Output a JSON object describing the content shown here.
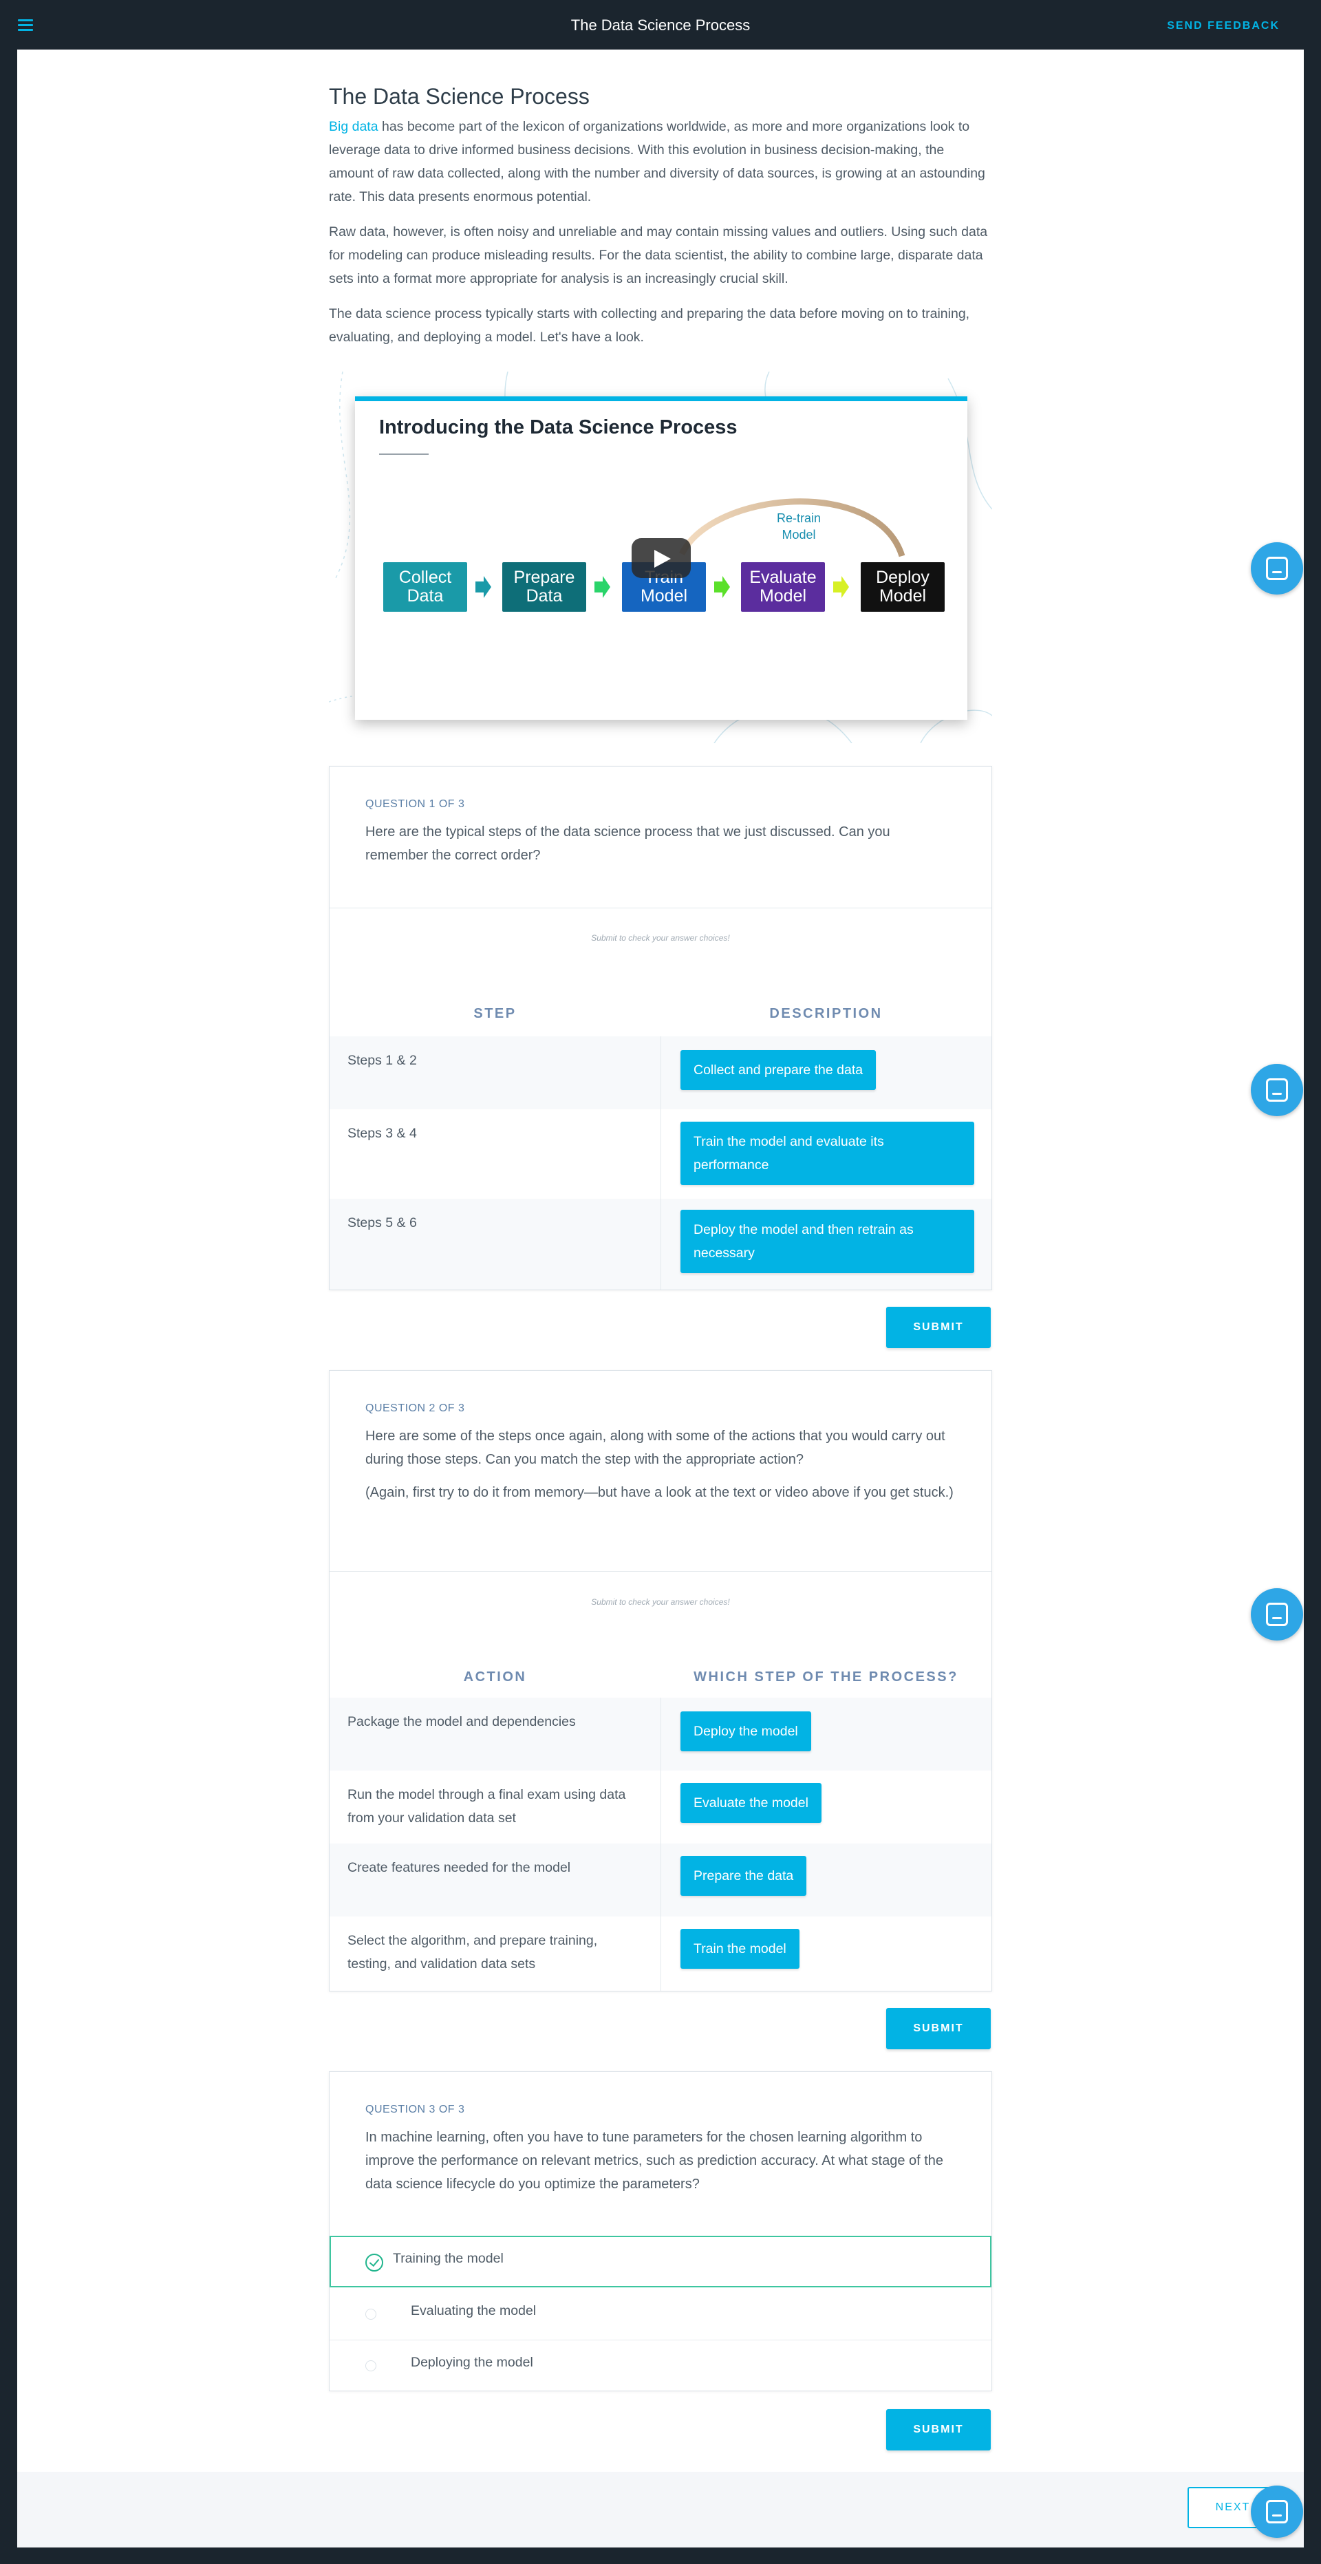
{
  "topbar": {
    "title": "The Data Science Process",
    "send_feedback": "SEND FEEDBACK"
  },
  "lesson": {
    "title": "The Data Science Process",
    "intro": {
      "link_text": "Big data",
      "p1_rest": " has become part of the lexicon of organizations worldwide, as more and more organizations look to leverage data to drive informed business decisions. With this evolution in business decision-making, the amount of raw data collected, along with the number and diversity of data sources, is growing at an astounding rate. This data presents enormous potential.",
      "p2": "Raw data, however, is often noisy and unreliable and may contain missing values and outliers. Using such data for modeling can produce misleading results. For the data scientist, the ability to combine large, disparate data sets into a format more appropriate for analysis is an increasingly crucial skill.",
      "p3": "The data science process typically starts with collecting and preparing the data before moving on to training, evaluating, and deploying a model. Let's have a look."
    }
  },
  "video": {
    "title": "Introducing the Data Science Process",
    "retrain_label": "Re-train Model",
    "steps": [
      {
        "label": "Collect Data",
        "color": "#1a9aa8"
      },
      {
        "label": "Prepare Data",
        "color": "#0e6e78"
      },
      {
        "label": "Train Model",
        "color": "#1565c0"
      },
      {
        "label": "Evaluate Model",
        "color": "#5b2d9e"
      },
      {
        "label": "Deploy Model",
        "color": "#111111"
      }
    ]
  },
  "q1": {
    "number": "QUESTION 1 OF 3",
    "text": "Here are the typical steps of the data science process that we just discussed. Can you remember the correct order?",
    "hint": "Submit to check your answer choices!",
    "col_left": "STEP",
    "col_right": "DESCRIPTION",
    "rows": [
      {
        "left": "Steps 1 & 2",
        "right": "Collect and prepare the data"
      },
      {
        "left": "Steps 3 & 4",
        "right": "Train the model and evaluate its performance"
      },
      {
        "left": "Steps 5 & 6",
        "right": "Deploy the model and then retrain as necessary"
      }
    ],
    "submit": "SUBMIT"
  },
  "q2": {
    "number": "QUESTION 2 OF 3",
    "text": "Here are some of the steps once again, along with some of the actions that you would carry out during those steps. Can you match the step with the appropriate action?",
    "text2": "(Again, first try to do it from memory—but have a look at the text or video above if you get stuck.)",
    "hint": "Submit to check your answer choices!",
    "col_left": "ACTION",
    "col_right": "WHICH STEP OF THE PROCESS?",
    "rows": [
      {
        "left": "Package the model and dependencies",
        "right": "Deploy the model"
      },
      {
        "left": "Run the model through a final exam using data from your validation data set",
        "right": "Evaluate the model"
      },
      {
        "left": "Create features needed for the model",
        "right": "Prepare the data"
      },
      {
        "left": "Select the algorithm, and prepare training, testing, and validation data sets",
        "right": "Train the model"
      }
    ],
    "submit": "SUBMIT"
  },
  "q3": {
    "number": "QUESTION 3 OF 3",
    "text": "In machine learning, often you have to tune parameters for the chosen learning algorithm to improve the performance on relevant metrics, such as prediction accuracy. At what stage of the data science lifecycle do you optimize the parameters?",
    "options": [
      {
        "label": "Training the model",
        "selected": true
      },
      {
        "label": "Evaluating the model",
        "selected": false
      },
      {
        "label": "Deploying the model",
        "selected": false
      }
    ],
    "submit": "SUBMIT"
  },
  "footer": {
    "next": "NEXT"
  }
}
